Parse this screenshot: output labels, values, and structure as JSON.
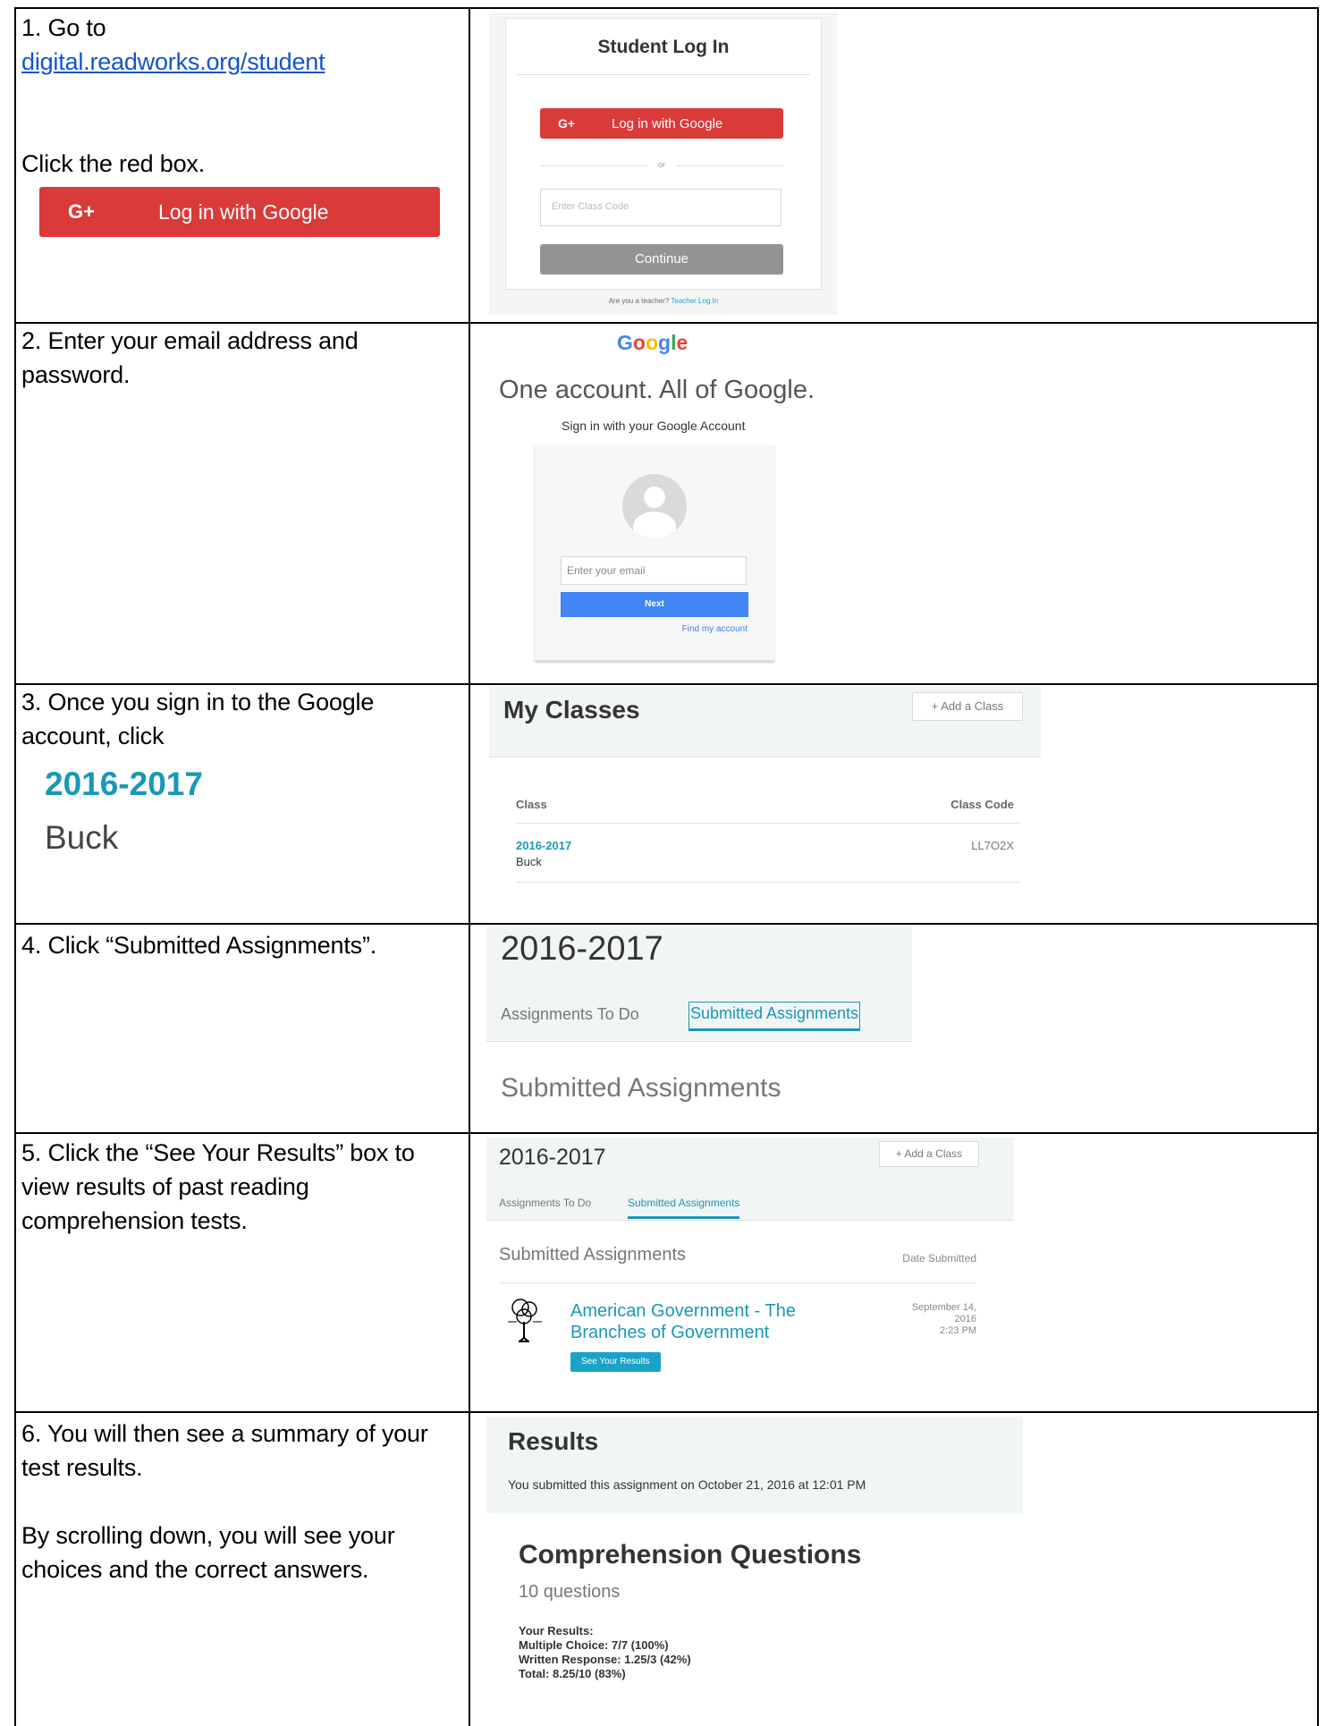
{
  "steps": [
    {
      "number": "1.",
      "text_before_link": "Go to",
      "link": "digital.readworks.org/student",
      "text2": "Click the red box.",
      "big_button": {
        "gplus": "G+",
        "label": "Log in with Google"
      },
      "screenshot": {
        "title": "Student Log In",
        "google_button": {
          "gplus": "G+",
          "label": "Log in with Google"
        },
        "or": "or",
        "class_code_placeholder": "Enter Class Code",
        "continue": "Continue",
        "teacher_text": "Are you a teacher?",
        "teacher_link": "Teacher Log In"
      }
    },
    {
      "number": "2.",
      "text": "Enter your email address and password.",
      "screenshot": {
        "logo_letters": [
          "G",
          "o",
          "o",
          "g",
          "l",
          "e"
        ],
        "heading": "One account. All of Google.",
        "sub": "Sign in with your Google Account",
        "email_placeholder": "Enter your email",
        "next": "Next",
        "find": "Find my account"
      }
    },
    {
      "number": "3.",
      "text": "Once you sign in to the Google account, click",
      "big_class": "2016-2017",
      "big_teacher": "Buck",
      "screenshot": {
        "title": "My Classes",
        "add_class": "+ Add a Class",
        "col_class": "Class",
        "col_code": "Class Code",
        "class_name": "2016-2017",
        "teacher": "Buck",
        "class_code": "LL7O2X"
      }
    },
    {
      "number": "4.",
      "text": "Click “Submitted Assignments”.",
      "screenshot": {
        "title": "2016-2017",
        "tab_todo": "Assignments To Do",
        "tab_submitted": "Submitted Assignments",
        "section": "Submitted Assignments"
      }
    },
    {
      "number": "5.",
      "text": "Click the “See Your Results” box to view results of past reading comprehension tests.",
      "screenshot": {
        "title": "2016-2017",
        "add_class": "+ Add a Class",
        "tab_todo": "Assignments To Do",
        "tab_submitted": "Submitted Assignments",
        "section": "Submitted Assignments",
        "date_header": "Date Submitted",
        "assignment_title": "American Government - The Branches of Government",
        "results_button": "See Your Results",
        "date_line1": "September 14,",
        "date_line2": "2016",
        "date_line3": "2:23 PM"
      }
    },
    {
      "number": "6.",
      "text": "You will then see a summary of your test results.",
      "text2": "By scrolling down, you will see your choices and the correct answers.",
      "screenshot": {
        "title": "Results",
        "submitted_on": "You submitted this assignment on October 21, 2016 at 12:01 PM",
        "section": "Comprehension Questions",
        "question_count": "10 questions",
        "results_label": "Your Results:",
        "multiple_choice": "Multiple Choice: 7/7 (100%)",
        "written_response": "Written Response: 1.25/3 (42%)",
        "total": "Total: 8.25/10 (83%)"
      }
    }
  ]
}
